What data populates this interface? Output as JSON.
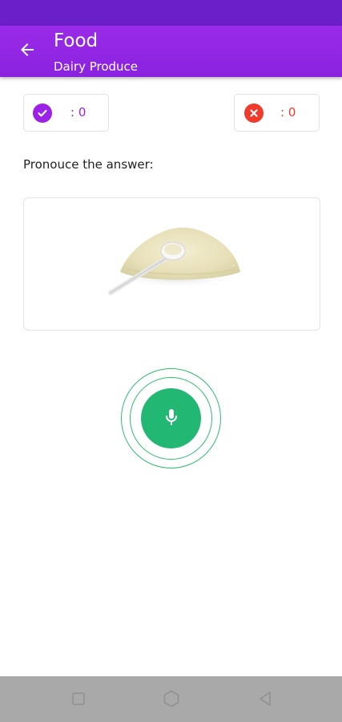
{
  "header": {
    "title": "Food",
    "subtitle": "Dairy Produce",
    "back_icon": "arrow-left-icon"
  },
  "score": {
    "correct_text": ": 0",
    "wrong_text": ": 0",
    "correct_icon": "check-circle-icon",
    "wrong_icon": "close-circle-icon"
  },
  "prompt": "Pronouce the answer:",
  "mic_icon": "microphone-icon",
  "colors": {
    "app_bar": "#8a22df",
    "status_bar": "#6a1fc9",
    "correct": "#9b22e6",
    "wrong": "#ef3a2c",
    "mic": "#22b873"
  },
  "nav": {
    "icons": [
      "square-icon",
      "home-hexagon-icon",
      "back-triangle-icon"
    ]
  }
}
